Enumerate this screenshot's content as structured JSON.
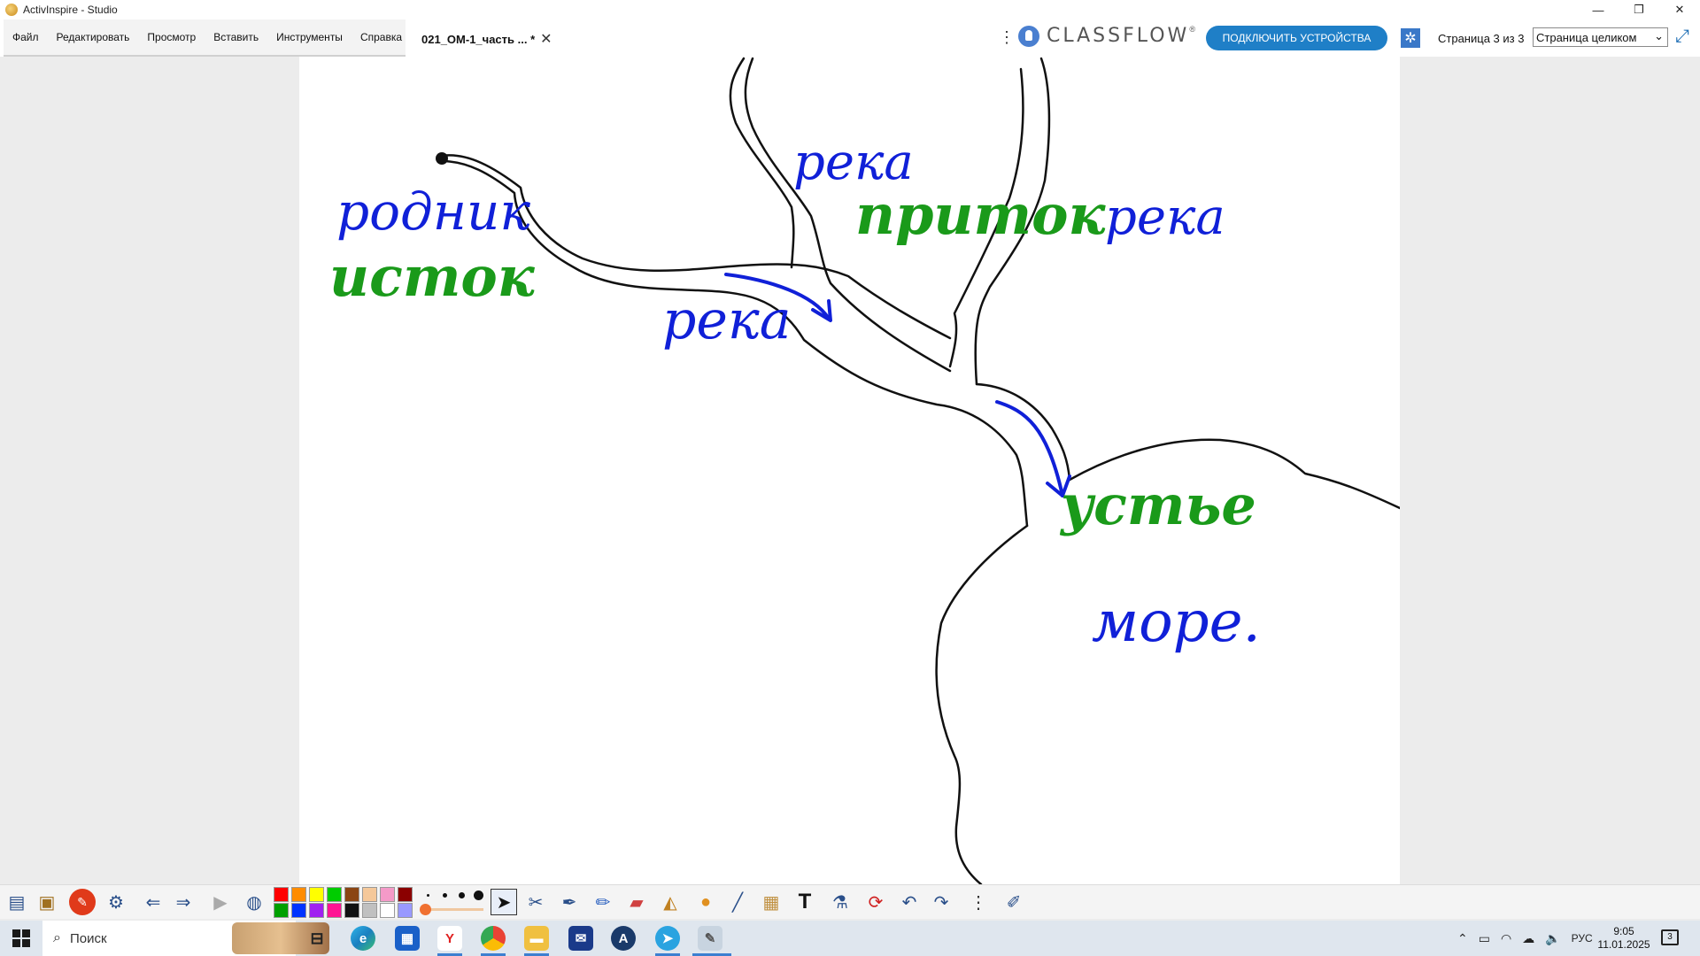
{
  "window": {
    "title": "ActivInspire - Studio",
    "controls": [
      "—",
      "❐",
      "✕"
    ]
  },
  "menu": {
    "items": [
      "Файл",
      "Редактировать",
      "Просмотр",
      "Вставить",
      "Инструменты",
      "Справка"
    ]
  },
  "tab": {
    "label": "021_ОМ-1_часть ... *",
    "close": "✕"
  },
  "more_glyph": "⋮",
  "classflow": {
    "brand": "CLASSFLOW",
    "tm": "®"
  },
  "connect_button": "ПОДКЛЮЧИТЬ УСТРОЙСТВА",
  "page_indicator": "Страница 3 из 3",
  "zoom": {
    "value": "Страница целиком",
    "chevron": "⌄"
  },
  "canvas": {
    "labels": {
      "spring": "родник",
      "source": "исток",
      "river_upper": "река",
      "tributary": "приток",
      "river_right": "река",
      "river_lower": "река",
      "mouth": "устье",
      "sea": "море."
    },
    "colors": {
      "blue": "#1020d8",
      "green": "#1a9a1a",
      "outline": "#111111"
    }
  },
  "toolbox": {
    "colors": [
      "#ff0000",
      "#ff8c00",
      "#ffff00",
      "#00cc00",
      "#8b4513",
      "#f5c89a",
      "#f49ac8",
      "#8b0000",
      "#00a000",
      "#0033ff",
      "#a020f0",
      "#ff1493",
      "#111111",
      "#c0c0c0",
      "#ffffff",
      "#9999ff"
    ],
    "tools": [
      "main-menu",
      "browsers",
      "reset",
      "desktop-annotate",
      "previous-page",
      "next-page",
      "play",
      "globe",
      "select",
      "magic-ink",
      "pen",
      "highlighter",
      "eraser",
      "fill",
      "shape",
      "connector",
      "camera",
      "text",
      "clear",
      "revert",
      "undo",
      "redo",
      "more",
      "pin"
    ]
  },
  "taskbar": {
    "search_label": "Поиск",
    "language": "РУС",
    "time": "9:05",
    "date": "11.01.2025",
    "notifications": "3"
  }
}
